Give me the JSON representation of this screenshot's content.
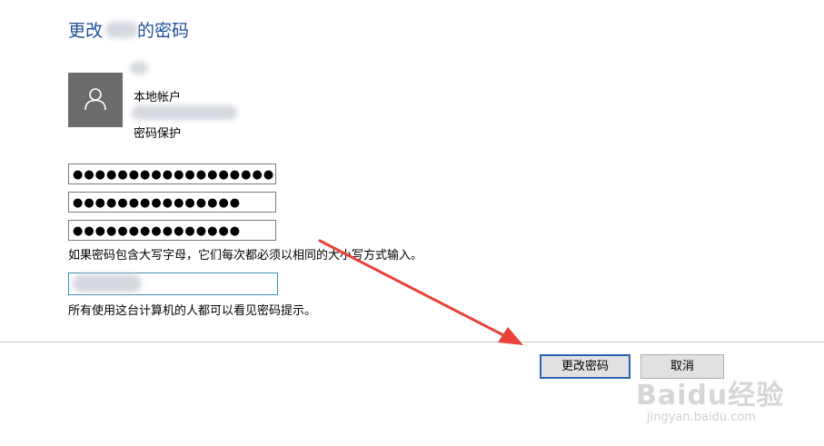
{
  "page": {
    "title": "更改 的密码",
    "title_prefix": "更改",
    "title_suffix": "的密码"
  },
  "account": {
    "avatar_icon": "user-icon",
    "line1": "本地帐户",
    "line2": "密码保护"
  },
  "fields": {
    "current_password": "●●●●●●●●●●●●●●●●●●●●●●●",
    "new_password": "●●●●●●●●●●●●●●●",
    "confirm_password": "●●●●●●●●●●●●●●●",
    "hint_value": ""
  },
  "notes": {
    "case_note": "如果密码包含大写字母，它们每次都必须以相同的大小写方式输入。",
    "hint_note": "所有使用这台计算机的人都可以看见密码提示。"
  },
  "buttons": {
    "change": "更改密码",
    "cancel": "取消"
  },
  "watermark": {
    "main": "Baidu经验",
    "sub": "jingyan.baidu.com"
  },
  "colors": {
    "title": "#1e4e9a",
    "arrow": "#e8423a",
    "primary_border": "#2b62b5"
  }
}
